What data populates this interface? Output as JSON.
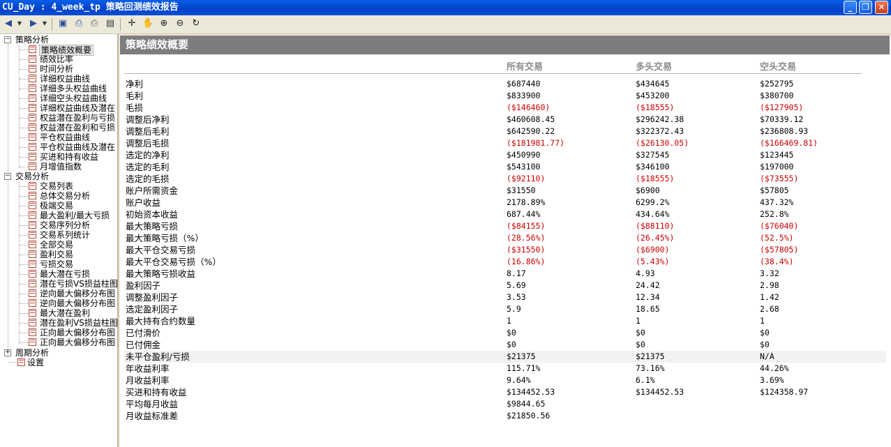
{
  "window": {
    "title": "CU_Day : 4_week_tp 策略回测绩效报告"
  },
  "toolbar_icons": [
    "back-icon",
    "forward-icon",
    "save-icon",
    "print-preview-icon",
    "print-icon",
    "export-icon",
    "crosshair-icon",
    "hand-icon",
    "zoom-in-icon",
    "zoom-out-icon",
    "refresh-icon"
  ],
  "tree": {
    "strategy": {
      "label": "策略分析",
      "items": [
        "策略绩效概要",
        "绩效比率",
        "时间分析",
        "详细权益曲线",
        "详细多头权益曲线",
        "详细空头权益曲线",
        "详细权益曲线及潜在",
        "权益潜在盈利与亏损",
        "权益潜在盈利和亏损",
        "平仓权益曲线",
        "平仓权益曲线及潜在",
        "买进和持有收益",
        "月增值指数"
      ]
    },
    "trade": {
      "label": "交易分析",
      "items": [
        "交易列表",
        "总体交易分析",
        "极端交易",
        "最大盈利/最大亏损",
        "交易序列分析",
        "交易系列统计",
        "全部交易",
        "盈利交易",
        "亏损交易",
        "最大潜在亏损",
        "潜在亏损VS损益柱图",
        "逆向最大偏移分布图",
        "逆向最大偏移分布图",
        "最大潜在盈利",
        "潜在盈利VS损益柱图",
        "正向最大偏移分布图",
        "正向最大偏移分布图"
      ]
    },
    "period": {
      "label": "周期分析"
    },
    "settings": {
      "label": "设置"
    }
  },
  "report": {
    "title": "策略绩效概要",
    "columns": [
      "所有交易",
      "多头交易",
      "空头交易"
    ],
    "rows": [
      {
        "label": "净利",
        "v": [
          "$687440",
          "$434645",
          "$252795"
        ]
      },
      {
        "label": "毛利",
        "v": [
          "$833900",
          "$453200",
          "$380700"
        ]
      },
      {
        "label": "毛损",
        "v": [
          "($146460)",
          "($18555)",
          "($127905)"
        ]
      },
      {
        "label": "调整后净利",
        "v": [
          "$460608.45",
          "$296242.38",
          "$70339.12"
        ]
      },
      {
        "label": "调整后毛利",
        "v": [
          "$642590.22",
          "$322372.43",
          "$236808.93"
        ]
      },
      {
        "label": "调整后毛损",
        "v": [
          "($181981.77)",
          "($26130.05)",
          "($166469.81)"
        ]
      },
      {
        "label": "选定的净利",
        "v": [
          "$450990",
          "$327545",
          "$123445"
        ]
      },
      {
        "label": "选定的毛利",
        "v": [
          "$543100",
          "$346100",
          "$197000"
        ]
      },
      {
        "label": "选定的毛损",
        "v": [
          "($92110)",
          "($18555)",
          "($73555)"
        ]
      },
      {
        "label": "账户所需资金",
        "v": [
          "$31550",
          "$6900",
          "$57805"
        ]
      },
      {
        "label": "账户收益",
        "v": [
          "2178.89%",
          "6299.2%",
          "437.32%"
        ]
      },
      {
        "label": "初始资本收益",
        "v": [
          "687.44%",
          "434.64%",
          "252.8%"
        ]
      },
      {
        "label": "最大策略亏损",
        "v": [
          "($84155)",
          "($88110)",
          "($76040)"
        ]
      },
      {
        "label": "最大策略亏损（%）",
        "v": [
          "(28.56%)",
          "(26.45%)",
          "(52.5%)"
        ]
      },
      {
        "label": "最大平仓交易亏损",
        "v": [
          "($31550)",
          "($6900)",
          "($57805)"
        ]
      },
      {
        "label": "最大平仓交易亏损（%）",
        "v": [
          "(16.86%)",
          "(5.43%)",
          "(38.4%)"
        ]
      },
      {
        "label": "最大策略亏损收益",
        "v": [
          "8.17",
          "4.93",
          "3.32"
        ]
      },
      {
        "label": "盈利因子",
        "v": [
          "5.69",
          "24.42",
          "2.98"
        ]
      },
      {
        "label": "调整盈利因子",
        "v": [
          "3.53",
          "12.34",
          "1.42"
        ]
      },
      {
        "label": "选定盈利因子",
        "v": [
          "5.9",
          "18.65",
          "2.68"
        ]
      },
      {
        "label": "最大持有合约数量",
        "v": [
          "1",
          "1",
          "1"
        ]
      },
      {
        "label": "已付滑价",
        "v": [
          "$0",
          "$0",
          "$0"
        ]
      },
      {
        "label": "已付佣金",
        "v": [
          "$0",
          "$0",
          "$0"
        ]
      },
      {
        "label": "未平仓盈利/亏损",
        "v": [
          "$21375",
          "$21375",
          "N/A"
        ],
        "hl": true
      },
      {
        "label": "年收益利率",
        "v": [
          "115.71%",
          "73.16%",
          "44.26%"
        ]
      },
      {
        "label": "月收益利率",
        "v": [
          "9.64%",
          "6.1%",
          "3.69%"
        ]
      },
      {
        "label": "买进和持有收益",
        "v": [
          "$134452.53",
          "$134452.53",
          "$124358.97"
        ]
      },
      {
        "label": "平均每月收益",
        "v": [
          "$9844.65",
          "",
          ""
        ]
      },
      {
        "label": "月收益标准差",
        "v": [
          "$21850.56",
          "",
          ""
        ]
      }
    ]
  }
}
